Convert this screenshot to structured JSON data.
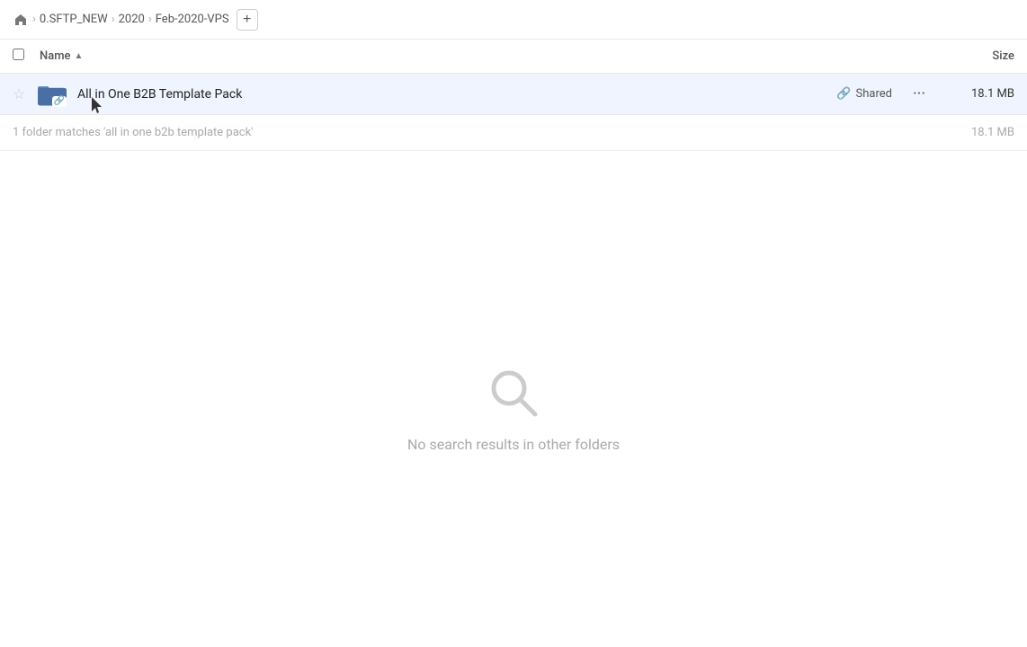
{
  "breadcrumb": {
    "home_label": "Home",
    "items": [
      {
        "label": "0.SFTP_NEW"
      },
      {
        "label": "2020"
      },
      {
        "label": "Feb-2020-VPS"
      }
    ],
    "add_button_label": "+"
  },
  "column_header": {
    "checkbox_label": "select-all",
    "name_label": "Name",
    "sort_arrow": "▲",
    "size_label": "Size"
  },
  "file_row": {
    "star_char": "★",
    "folder_name": "All in One B2B Template Pack",
    "shared_label": "Shared",
    "more_icon": "···",
    "size": "18.1 MB"
  },
  "search_info": {
    "text": "1 folder matches 'all in one b2b template pack'",
    "size": "18.1 MB"
  },
  "empty_state": {
    "icon_label": "no-results-search-icon",
    "text": "No search results in other folders"
  }
}
